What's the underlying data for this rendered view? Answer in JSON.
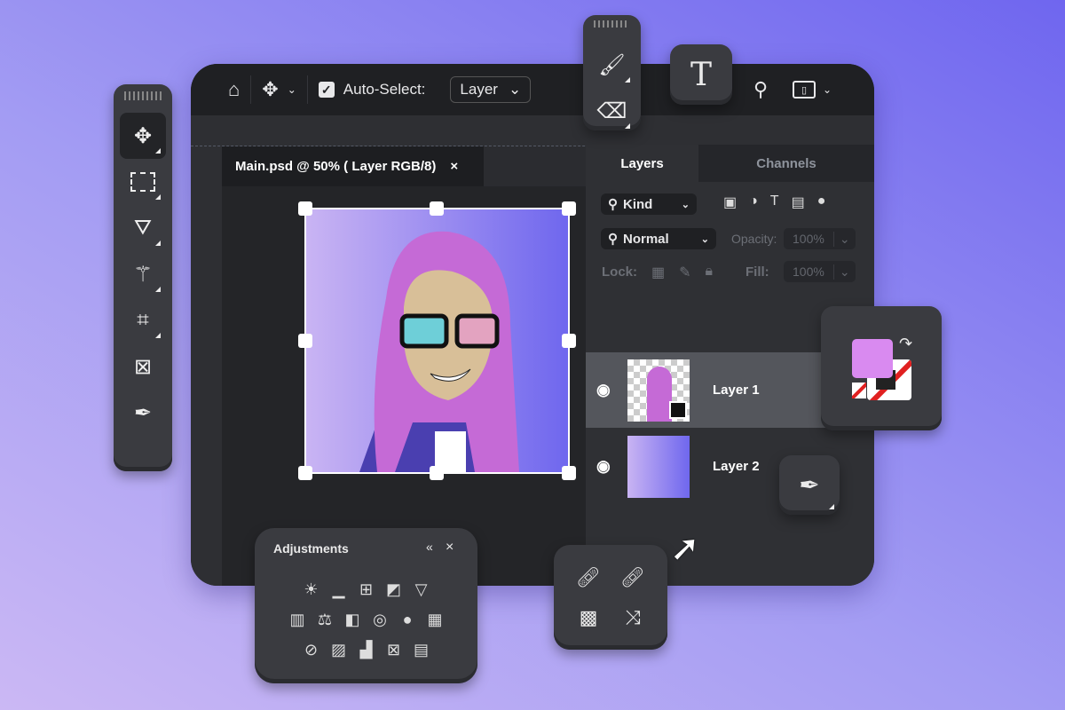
{
  "toolbar": {
    "home_icon": "home-icon",
    "move_icon": "move-icon",
    "auto_select_label": "Auto-Select:",
    "auto_select_checked": true,
    "layer_select_value": "Layer"
  },
  "document": {
    "tab_title": "Main.psd @ 50% ( Layer RGB/8)",
    "close": "×"
  },
  "layers_panel": {
    "tabs": [
      {
        "label": "Layers",
        "active": true
      },
      {
        "label": "Channels",
        "active": false
      }
    ],
    "kind_filter": "Kind",
    "blend_mode": "Normal",
    "opacity_label": "Opacity:",
    "opacity_value": "100%",
    "lock_label": "Lock:",
    "fill_label": "Fill:",
    "fill_value": "100%",
    "layers": [
      {
        "name": "Layer 1",
        "selected": true,
        "visible": true
      },
      {
        "name": "Layer 2",
        "selected": false,
        "visible": true
      }
    ]
  },
  "tools": [
    "move",
    "marquee",
    "lasso",
    "magic-wand",
    "crop",
    "frame",
    "eyedropper"
  ],
  "adjustments": {
    "title": "Adjustments",
    "collapse": "«",
    "close": "×"
  },
  "colors": {
    "accent": "#7a6ff0",
    "background_start": "#cbb8f4",
    "background_end": "#6f66ef",
    "swatch_fg": "#d98af0"
  }
}
